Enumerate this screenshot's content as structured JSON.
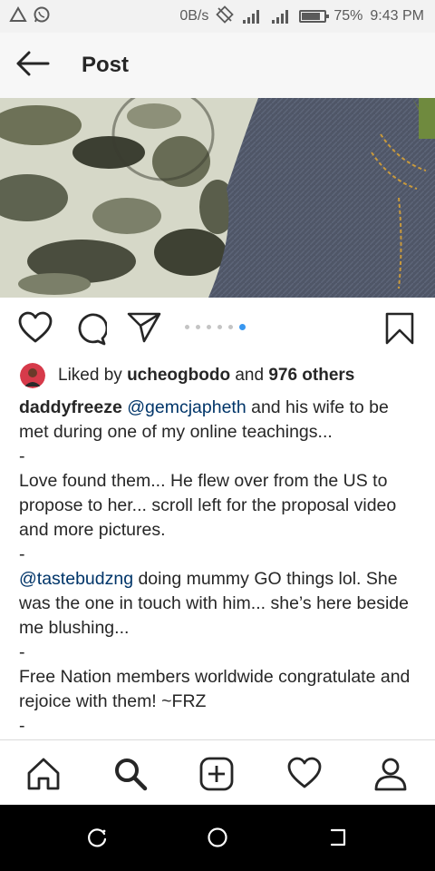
{
  "status_bar": {
    "speed": "0B/s",
    "battery_percent": "75%",
    "battery_level": 0.75,
    "time": "9:43 PM",
    "icons": [
      "alert-triangle-icon",
      "whatsapp-icon",
      "no-data-icon",
      "signal-icon",
      "hd-signal-icon",
      "battery-icon"
    ]
  },
  "header": {
    "back_icon": "back-arrow-icon",
    "title": "Post"
  },
  "post": {
    "image_alt": "camouflage-and-denim-photo",
    "carousel": {
      "count": 6,
      "active_index": 5
    }
  },
  "actions": {
    "like_icon": "heart-icon",
    "comment_icon": "comment-icon",
    "share_icon": "send-icon",
    "save_icon": "bookmark-icon"
  },
  "likes": {
    "prefix": "Liked by",
    "user": "ucheogbodo",
    "joiner": "and",
    "others": "976 others"
  },
  "caption": {
    "username": "daddyfreeze",
    "mention1": "@gemcjapheth",
    "text1": " and his wife to be met during one of my online teachings...",
    "sep1": "-",
    "text2": "Love found them... He flew over from the US to propose to her... scroll left for the proposal video and more pictures.",
    "sep2": "-",
    "mention2": "@tastebudzng",
    "text3": " doing mummy GO things lol. She was the one in touch with him... she’s here beside me blushing...",
    "sep3": "-",
    "text4": "Free Nation members worldwide congratulate and rejoice with them! ~FRZ",
    "sep4": "-"
  },
  "tab_bar": {
    "tabs": [
      "home-icon",
      "search-icon",
      "new-post-icon",
      "activity-heart-icon",
      "profile-icon"
    ]
  },
  "nav_bar": {
    "buttons": [
      "recent-apps-icon",
      "home-circle-icon",
      "back-icon"
    ]
  },
  "colors": {
    "mention": "#003569",
    "active_dot": "#3897f0",
    "text": "#262626"
  }
}
